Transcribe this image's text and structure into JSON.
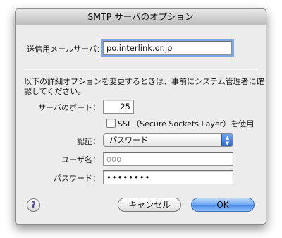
{
  "window": {
    "title": "SMTP サーバのオプション"
  },
  "server": {
    "label": "送信用メールサーバ：",
    "value": "po.interlink.or.jp"
  },
  "notice": {
    "line1": "以下の詳細オプションを変更するときは、事前にシステム管理者に確",
    "line2": "認してください。"
  },
  "port": {
    "label": "サーバのポート：",
    "value": "25"
  },
  "ssl": {
    "label": "SSL（Secure Sockets Layer）を使用",
    "checked": false
  },
  "auth": {
    "label": "認証：",
    "selected": "パスワード"
  },
  "username": {
    "label": "ユーザ名：",
    "value": "ooo"
  },
  "password": {
    "label": "パスワード：",
    "value": "••••••••"
  },
  "buttons": {
    "help": "?",
    "cancel": "キャンセル",
    "ok": "OK"
  },
  "colors": {
    "accent": "#4a8ae8",
    "focus_ring": "#7ea7e0",
    "help_glyph": "#5b3fa6"
  }
}
